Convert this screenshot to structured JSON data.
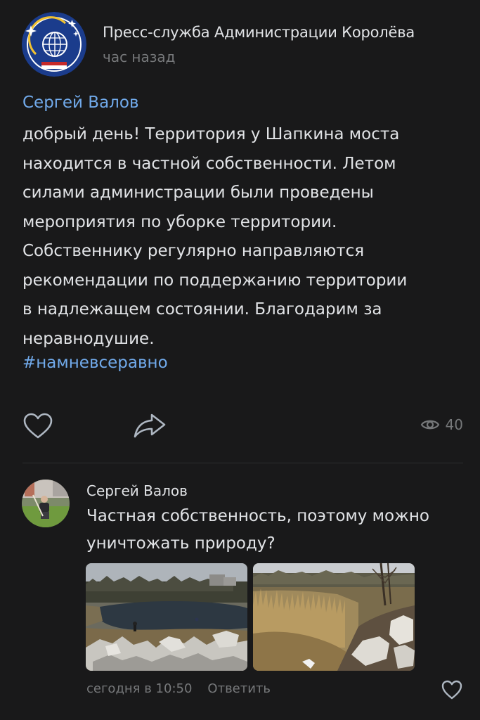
{
  "post": {
    "author": "Пресс-служба Администрации Королёва",
    "time": "час назад",
    "reply_to": "Сергей Валов",
    "text_lines": [
      "добрый день! Территория у Шапкина моста",
      "находится в частной собственности. Летом",
      "силами администрации были проведены",
      "мероприятия по уборке территории.",
      "Собственнику регулярно направляются",
      "рекомендации по поддержанию территории",
      "в надлежащем состоянии. Благодарим за",
      "неравнодушие."
    ],
    "hashtag": "#намневсеравно",
    "views": "40"
  },
  "comment": {
    "author": "Сергей Валов",
    "text_lines": [
      "Частная собственность, поэтому можно",
      "уничтожать природу?"
    ],
    "time": "сегодня в 10:50",
    "reply_label": "Ответить"
  },
  "colors": {
    "background": "#19191a",
    "text": "#e1e3e6",
    "secondary": "#76787a",
    "link": "#71aaeb"
  },
  "icons": [
    "like-icon",
    "share-icon",
    "views-eye-icon",
    "comment-like-icon"
  ]
}
